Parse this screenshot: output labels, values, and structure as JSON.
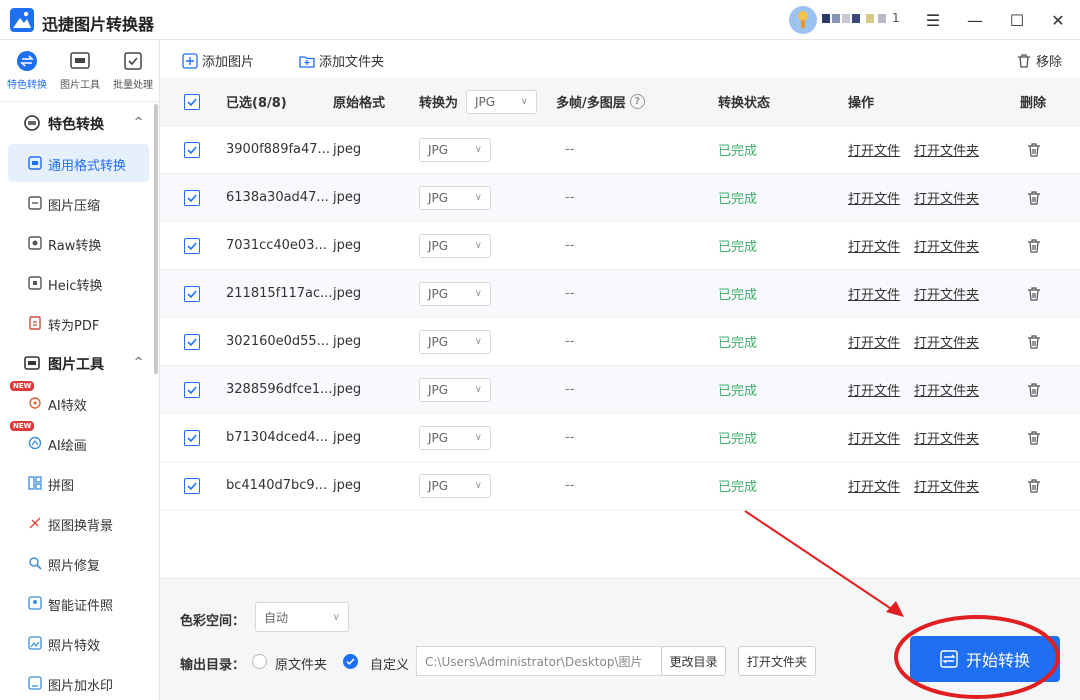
{
  "app": {
    "title": "迅捷图片转换器",
    "username_suffix": "1"
  },
  "window_controls": {
    "menu": "☰",
    "minimize": "—",
    "maximize": "☐",
    "close": "✕"
  },
  "top_tabs": [
    {
      "label": "特色转换",
      "icon": "feature-convert-icon"
    },
    {
      "label": "图片工具",
      "icon": "image-tool-icon"
    },
    {
      "label": "批量处理",
      "icon": "batch-process-icon"
    }
  ],
  "sidebar": {
    "section1": {
      "title": "特色转换",
      "icon": "convert-section-icon"
    },
    "section1_items": [
      {
        "label": "通用格式转换",
        "icon": "format-convert-icon"
      },
      {
        "label": "图片压缩",
        "icon": "compress-icon"
      },
      {
        "label": "Raw转换",
        "icon": "raw-icon"
      },
      {
        "label": "Heic转换",
        "icon": "heic-icon"
      },
      {
        "label": "转为PDF",
        "icon": "pdf-icon"
      }
    ],
    "section2": {
      "title": "图片工具",
      "icon": "image-tool-section-icon"
    },
    "section2_items": [
      {
        "label": "AI特效",
        "icon": "ai-effect-icon",
        "badge": "NEW"
      },
      {
        "label": "AI绘画",
        "icon": "ai-paint-icon",
        "badge": "NEW"
      },
      {
        "label": "拼图",
        "icon": "collage-icon"
      },
      {
        "label": "抠图换背景",
        "icon": "cutout-icon"
      },
      {
        "label": "照片修复",
        "icon": "repair-icon"
      },
      {
        "label": "智能证件照",
        "icon": "id-photo-icon"
      },
      {
        "label": "照片特效",
        "icon": "photo-effect-icon"
      },
      {
        "label": "图片加水印",
        "icon": "watermark-icon"
      }
    ]
  },
  "toolbar": {
    "add_image": "添加图片",
    "add_folder": "添加文件夹",
    "remove": "移除"
  },
  "table": {
    "headers": {
      "selected": "已选(8/8)",
      "orig_format": "原始格式",
      "convert_to": "转换为",
      "convert_to_value": "JPG",
      "multiframe": "多帧/多图层",
      "status": "转换状态",
      "actions": "操作",
      "delete": "删除"
    },
    "rows": [
      {
        "name": "3900f889fa47...",
        "format": "jpeg",
        "target": "JPG",
        "frames": "--",
        "status": "已完成",
        "open_file": "打开文件",
        "open_folder": "打开文件夹"
      },
      {
        "name": "6138a30ad47...",
        "format": "jpeg",
        "target": "JPG",
        "frames": "--",
        "status": "已完成",
        "open_file": "打开文件",
        "open_folder": "打开文件夹"
      },
      {
        "name": "7031cc40e03...",
        "format": "jpeg",
        "target": "JPG",
        "frames": "--",
        "status": "已完成",
        "open_file": "打开文件",
        "open_folder": "打开文件夹"
      },
      {
        "name": "211815f117ac...",
        "format": "jpeg",
        "target": "JPG",
        "frames": "--",
        "status": "已完成",
        "open_file": "打开文件",
        "open_folder": "打开文件夹"
      },
      {
        "name": "302160e0d55...",
        "format": "jpeg",
        "target": "JPG",
        "frames": "--",
        "status": "已完成",
        "open_file": "打开文件",
        "open_folder": "打开文件夹"
      },
      {
        "name": "3288596dfce1...",
        "format": "jpeg",
        "target": "JPG",
        "frames": "--",
        "status": "已完成",
        "open_file": "打开文件",
        "open_folder": "打开文件夹"
      },
      {
        "name": "b71304dced4...",
        "format": "jpeg",
        "target": "JPG",
        "frames": "--",
        "status": "已完成",
        "open_file": "打开文件",
        "open_folder": "打开文件夹"
      },
      {
        "name": "bc4140d7bc9...",
        "format": "jpeg",
        "target": "JPG",
        "frames": "--",
        "status": "已完成",
        "open_file": "打开文件",
        "open_folder": "打开文件夹"
      }
    ]
  },
  "bottom": {
    "color_space_label": "色彩空间：",
    "color_space_value": "自动",
    "output_dir_label": "输出目录：",
    "option_original": "原文件夹",
    "option_custom": "自定义",
    "path": "C:\\Users\\Administrator\\Desktop\\图片",
    "change_dir": "更改目录",
    "open_folder": "打开文件夹",
    "start": "开始转换"
  },
  "colors": {
    "accent": "#1e6ff2",
    "success": "#3fae6a",
    "annotation": "#e02020"
  }
}
